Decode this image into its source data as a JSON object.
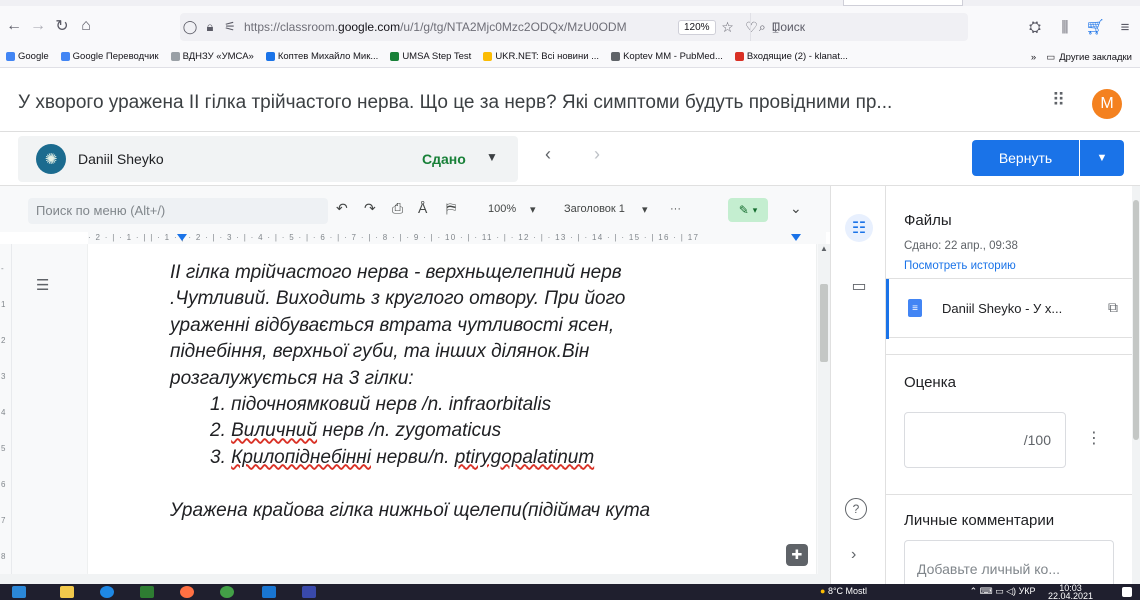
{
  "browser": {
    "url_prefix": "https://classroom.",
    "url_domain": "google.com",
    "url_path": "/u/1/g/tg/NTA2Mjc0Mzc2ODQx/MzU0ODM",
    "zoom": "120%",
    "search_placeholder": "Поиск"
  },
  "bookmarks": {
    "items": [
      {
        "label": "Google",
        "color": "#4285f4"
      },
      {
        "label": "Google Переводчик",
        "color": "#4285f4"
      },
      {
        "label": "ВДНЗУ «УМСА»",
        "color": "#9aa0a6"
      },
      {
        "label": "Коптев Михайло Мик...",
        "color": "#1a73e8"
      },
      {
        "label": "UMSA Step Test",
        "color": "#188038"
      },
      {
        "label": "UKR.NET: Всі новини ...",
        "color": "#fbbc04"
      },
      {
        "label": "Koptev MM - PubMed...",
        "color": "#5f6368"
      },
      {
        "label": "Входящие (2) - klanat...",
        "color": "#d93025"
      }
    ],
    "overflow": "»",
    "other": "Другие закладки"
  },
  "classroom": {
    "title": "У хворого уражена ІІ гілка трійчастого нерва. Що це за нерв? Які симптоми будуть провідними пр...",
    "avatar_letter": "M",
    "student_name": "Daniil Sheyko",
    "status": "Сдано",
    "return_label": "Вернуть"
  },
  "docs": {
    "menu_search": "Поиск по меню (Alt+/)",
    "zoom": "100%",
    "style": "Заголовок 1",
    "ruler": "· 2 · | · 1 · |      | · 1 · | · 2 · | · 3 · | · 4 · | · 5 · | · 6 · | · 7 · | · 8 · | · 9 · | · 10 · | · 11 · | · 12 · | · 13 · | · 14 · | · 15 · |   16 · | 17",
    "vruler": [
      "-",
      "1",
      "2",
      "3",
      "4",
      "5",
      "6",
      "7",
      "8"
    ],
    "paragraph1": [
      "ІІ гілка трійчастого нерва - верхньщелепний нерв",
      ".Чутливий.  Виходить з круглого  отвору. При його",
      "ураженні відбувається втрата чутливості ясен,",
      "піднебіння, верхньої губи, та інших ділянок.Він",
      "розгалужується на 3 гілки:"
    ],
    "list": [
      {
        "num": "1. ",
        "text": "підочноямковий нерв /n. infraorbitalis",
        "under": ""
      },
      {
        "num": "2. ",
        "pre": "",
        "under": "Виличний",
        "post": " нерв /n. zygomaticus"
      },
      {
        "num": "3. ",
        "pre": "",
        "under": "Крилопіднебінні",
        "post": " нерви/n. ",
        "under2": "ptirygopalatinum"
      }
    ],
    "paragraph2": "Уражена крайова гілка нижньої щелепи(підіймач кута"
  },
  "panel": {
    "files_title": "Файлы",
    "submitted": "Сдано: 22 апр., 09:38",
    "history_link": "Посмотреть историю",
    "file_name": "Daniil Sheyko - У х...",
    "grade_title": "Оценка",
    "grade_value": "/100",
    "comments_title": "Личные комментарии",
    "comment_placeholder": "Добавьте личный ко..."
  },
  "taskbar": {
    "weather": "8°C  Mostl",
    "lang": "УКР",
    "time": "10:03",
    "date": "22.04.2021"
  },
  "colors": {
    "accent": "#1a73e8",
    "status_green": "#188038",
    "avatar_orange": "#f4811f"
  }
}
